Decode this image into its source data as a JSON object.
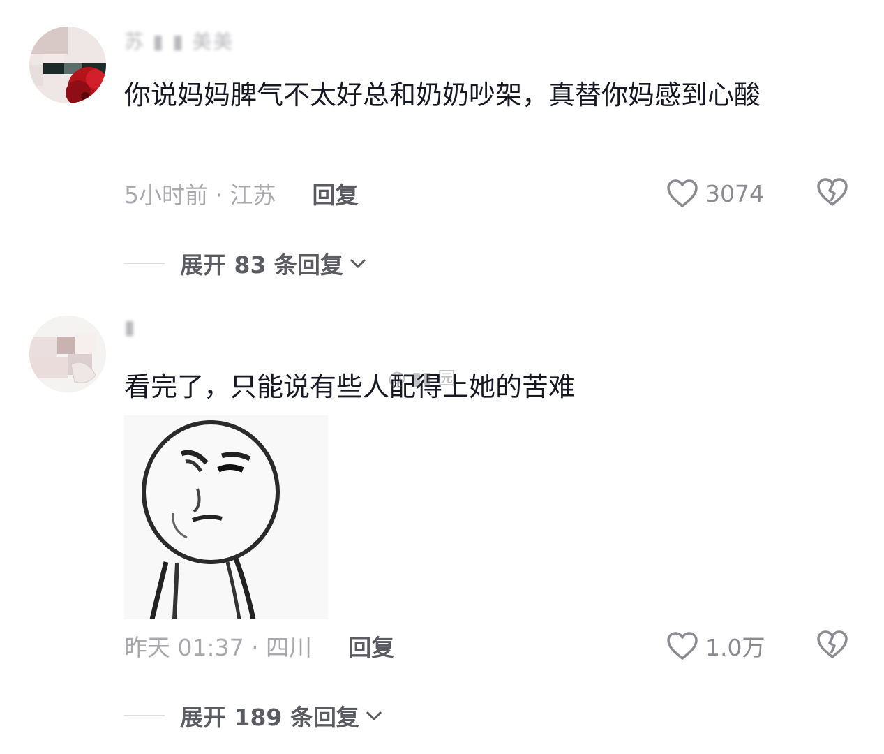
{
  "comments": [
    {
      "username": "苏 ▮ ▮ 美美",
      "text": "你说妈妈脾气不太好总和奶奶吵架，真替你妈感到心酸",
      "time_location": "5小时前 · 江苏",
      "reply_label": "回复",
      "like_count": "3074",
      "expand_label": "展开 83 条回复"
    },
    {
      "username": "▮",
      "text": "看完了，只能说有些人配得上她的苦难",
      "time_location": "昨天 01:37 · 四川",
      "reply_label": "回复",
      "like_count": "1.0万",
      "expand_label": "展开 189 条回复"
    }
  ],
  "watermark": "@ ▮▮ 园",
  "icons": {
    "like": "heart-outline-icon",
    "dislike": "broken-heart-icon",
    "expand": "chevron-down-icon"
  },
  "colors": {
    "text": "#161823",
    "secondary": "#a8a8ad",
    "emphasis": "#5b5b62"
  }
}
